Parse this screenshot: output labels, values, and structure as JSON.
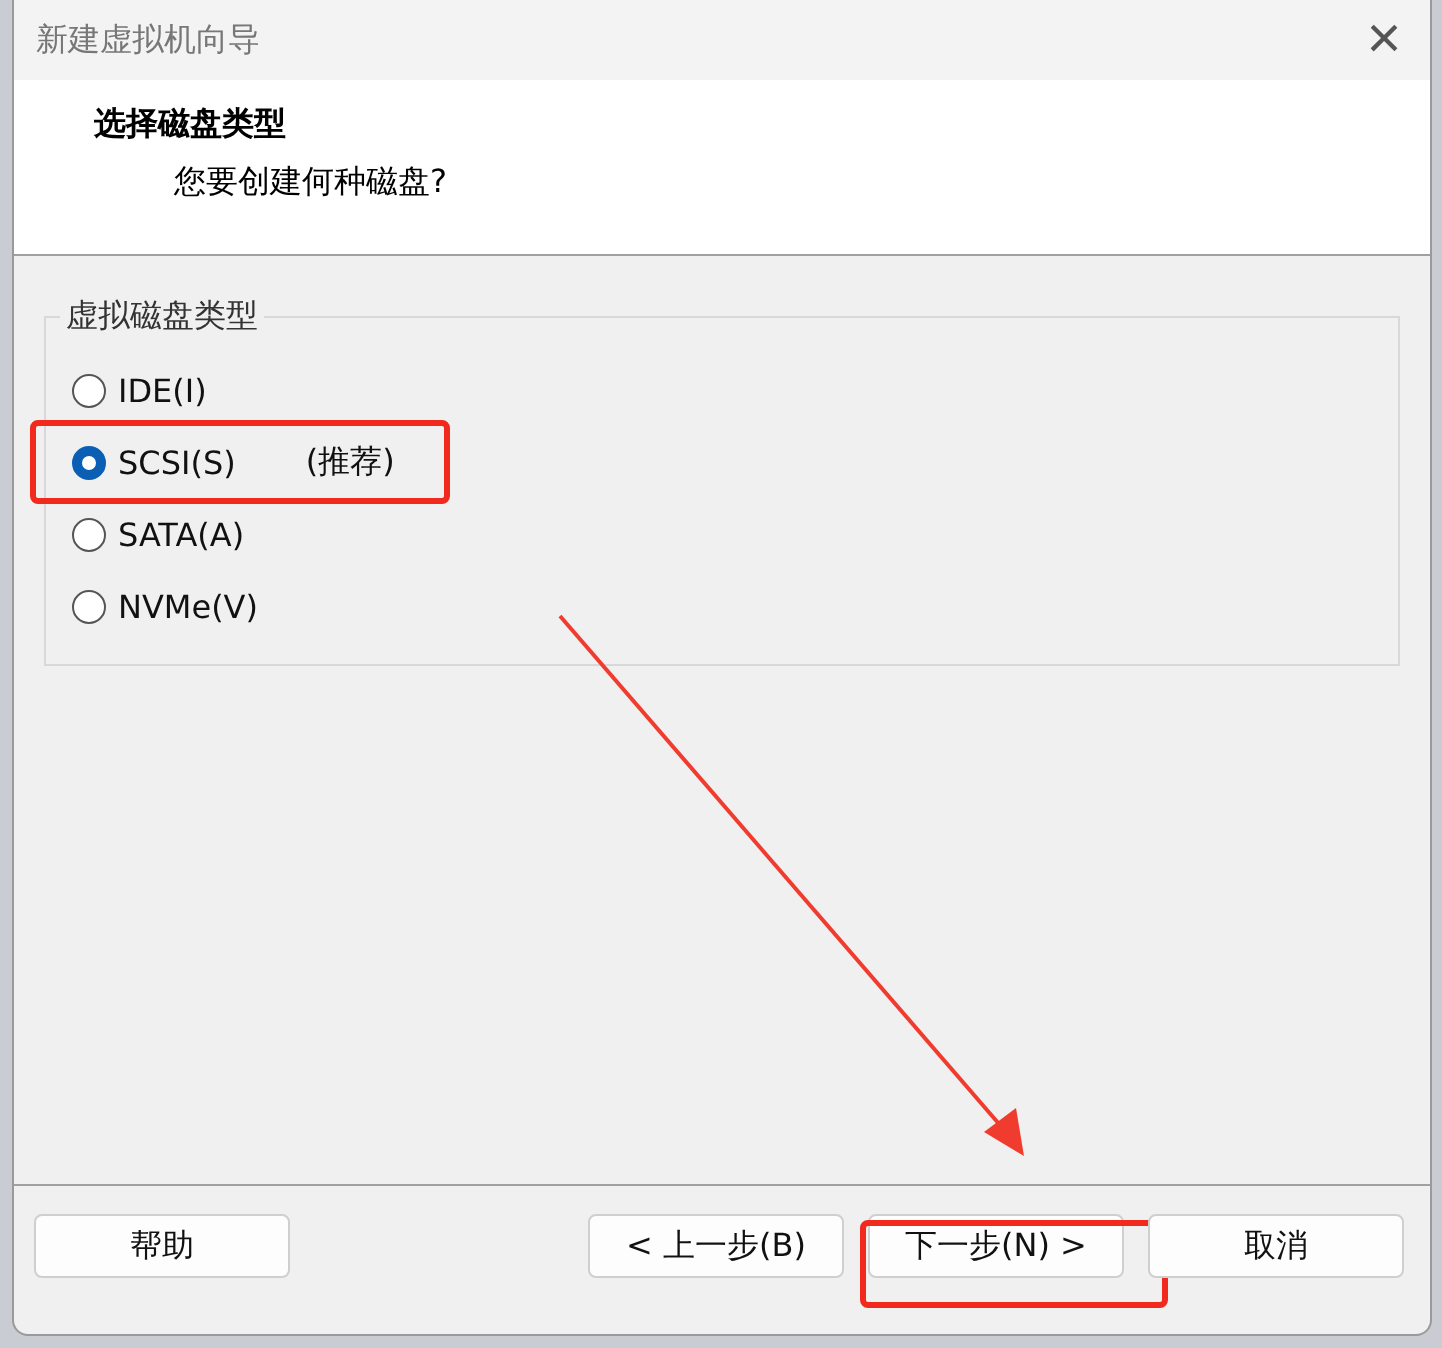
{
  "window": {
    "title": "新建虚拟机向导",
    "close": "×"
  },
  "header": {
    "title": "选择磁盘类型",
    "subtitle": "您要创建何种磁盘?"
  },
  "group": {
    "label": "虚拟磁盘类型",
    "options": [
      {
        "label": "IDE(I)",
        "selected": false,
        "highlighted": false
      },
      {
        "label": "SCSI(S)",
        "note": "(推荐)",
        "selected": true,
        "highlighted": true
      },
      {
        "label": "SATA(A)",
        "selected": false,
        "highlighted": false
      },
      {
        "label": "NVMe(V)",
        "selected": false,
        "highlighted": false
      }
    ]
  },
  "buttons": [
    {
      "label": "帮助",
      "kind": "left",
      "highlighted": false
    },
    {
      "label": "< 上一步(B)",
      "kind": "right",
      "highlighted": false
    },
    {
      "label": "下一步(N) >",
      "kind": "right",
      "highlighted": true
    },
    {
      "label": "取消",
      "kind": "right",
      "highlighted": false
    }
  ]
}
